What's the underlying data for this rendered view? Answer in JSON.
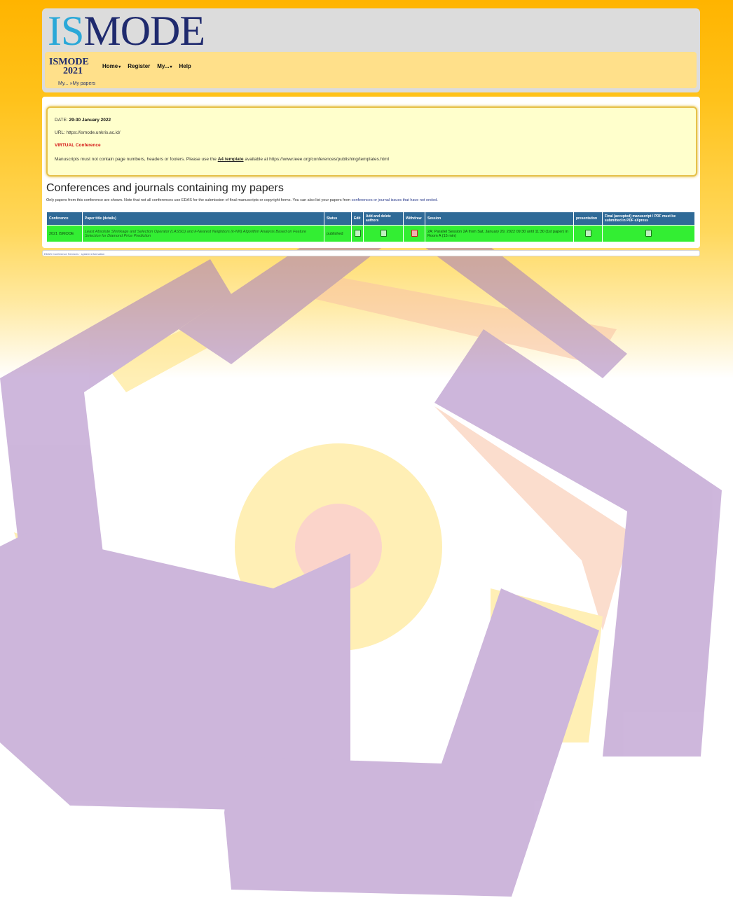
{
  "brand": {
    "logo_part1": "IS",
    "logo_part2": "MODE",
    "small_logo_line1": "ISMODE",
    "small_logo_year": "2021"
  },
  "nav": {
    "items": [
      {
        "label": "Home",
        "has_caret": true
      },
      {
        "label": "Register",
        "has_caret": false
      },
      {
        "label": "My...",
        "has_caret": true
      },
      {
        "label": "Help",
        "has_caret": false
      }
    ],
    "caret": "▾"
  },
  "breadcrumb": "My... »My papers",
  "notice": {
    "date_label": "DATE:",
    "date_value": "29-30 January 2022",
    "url_text": "URL: https://ismode.unkris.ac.id/",
    "virtual": "VIRTUAL Conference",
    "manuscript_text": "Manuscripts must not contain page numbers, headers or footers. Please use the",
    "template_link": "A4 template",
    "available_text": "available at https://www.ieee.org/conferences/publishing/templates.html"
  },
  "section": {
    "title": "Conferences and journals containing my papers",
    "desc_before": "Only papers from this conference are shown. Note that not all conferences use EDAS for the submission of final manuscripts or copyright forms. You can also list your papers from",
    "desc_link": "conferences or journal issues that have not ended."
  },
  "table": {
    "headers": [
      "Conference",
      "Paper title (details)",
      "Status",
      "Edit",
      "Add and delete authors",
      "Withdraw",
      "Session",
      "presentation",
      "Final (accepted) manuscript / PDF must be submitted in PDF eXpress"
    ],
    "rows": [
      {
        "conference": "2021 ISMODE",
        "title": "Least Absolute Shrinkage and Selection Operator (LASSO) and k-Nearest Neighbors (k-NN) Algorithm Analysis Based on Feature Selection for Diamond Price Prediction",
        "status": "published",
        "session": "2A: Parallel Session 2A from Sat, January 29, 2022 09:30 until 11:30 (1st paper) in Room A (15 min)"
      }
    ]
  },
  "footer": "EDAS Conference Services · system information"
}
